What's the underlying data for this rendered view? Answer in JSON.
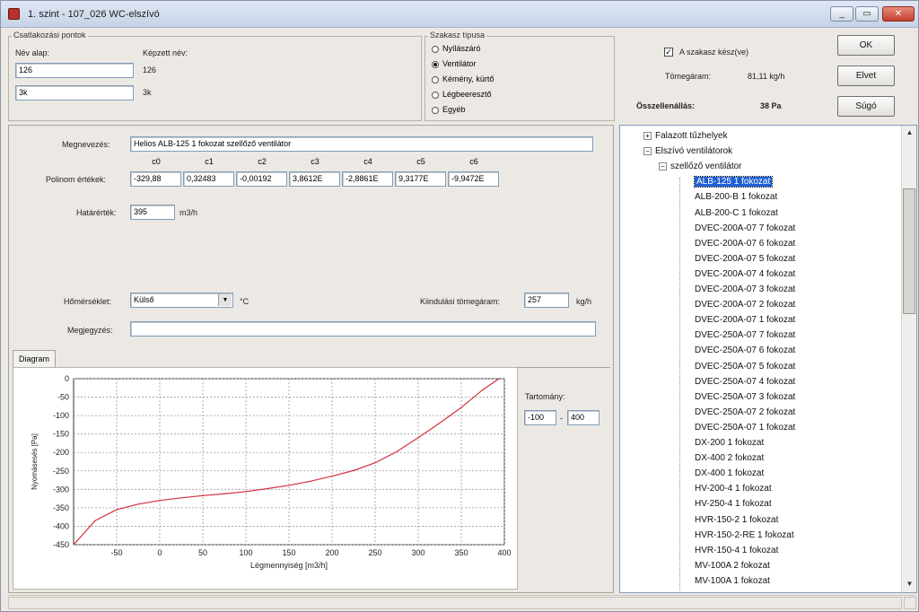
{
  "window": {
    "title": "1. szint - 107_026 WC-elszívó",
    "controls": {
      "minimize": "_",
      "maximize": "▭",
      "close": "✕"
    }
  },
  "connection_points": {
    "group_label": "Csatlakozási pontok",
    "name_base_label": "Név alap:",
    "generated_name_label": "Képzett név:",
    "inputs": [
      "126",
      "3k"
    ],
    "generated": [
      "126",
      "3k"
    ]
  },
  "section_type": {
    "group_label": "Szakasz típusa",
    "options": [
      "Nyílászáró",
      "Ventilátor",
      "Kémény, kürtő",
      "Légbeeresztő",
      "Egyéb"
    ],
    "selected": "Ventilátor"
  },
  "right_info": {
    "checkbox_label": "A szakasz kész(ve)",
    "checkbox_checked": true,
    "mass_flow_label": "Tömegáram:",
    "mass_flow_value": "81,11 kg/h",
    "total_resistance_label": "Összellenállás:",
    "total_resistance_value": "38 Pa"
  },
  "buttons": {
    "ok": "OK",
    "cancel": "Elvet",
    "help": "Súgó"
  },
  "form": {
    "name_label": "Megnevezés:",
    "name_value": "Helios ALB-125 1 fokozat szellőző ventilátor",
    "poly_label": "Polinom értékek:",
    "coef_headers": [
      "c0",
      "c1",
      "c2",
      "c3",
      "c4",
      "c5",
      "c6"
    ],
    "coef_values": [
      "-329,88",
      "0,32483",
      "-0,00192",
      "3,8612E",
      "-2,8861E",
      "9,3177E",
      "-9,9472E"
    ],
    "limit_label": "Határérték:",
    "limit_value": "395",
    "limit_unit": "m3/h",
    "temp_label": "Hőmérséklet:",
    "temp_value": "Külső",
    "temp_unit": "°C",
    "outflow_label": "Kiindulási tömegáram:",
    "outflow_value": "257",
    "outflow_unit": "kg/h",
    "note_label": "Megjegyzés:",
    "note_value": ""
  },
  "tab": {
    "diagram": "Diagram"
  },
  "range": {
    "label": "Tartomány:",
    "from": "-100",
    "sep": "-",
    "to": "400"
  },
  "tree": {
    "nodes": [
      {
        "label": "Falazott tűzhelyek",
        "level": 0,
        "expander": "+"
      },
      {
        "label": "Elszívó ventilátorok",
        "level": 0,
        "expander": "-"
      },
      {
        "label": "szellőző ventilátor",
        "level": 1,
        "expander": "-"
      },
      {
        "label": "ALB-125 1 fokozat",
        "level": 2,
        "selected": true
      },
      {
        "label": "ALB-200-B 1 fokozat",
        "level": 2
      },
      {
        "label": "ALB-200-C 1 fokozat",
        "level": 2
      },
      {
        "label": "DVEC-200A-07 7 fokozat",
        "level": 2
      },
      {
        "label": "DVEC-200A-07 6 fokozat",
        "level": 2
      },
      {
        "label": "DVEC-200A-07 5 fokozat",
        "level": 2
      },
      {
        "label": "DVEC-200A-07 4 fokozat",
        "level": 2
      },
      {
        "label": "DVEC-200A-07 3 fokozat",
        "level": 2
      },
      {
        "label": "DVEC-200A-07 2 fokozat",
        "level": 2
      },
      {
        "label": "DVEC-200A-07 1 fokozat",
        "level": 2
      },
      {
        "label": "DVEC-250A-07 7 fokozat",
        "level": 2
      },
      {
        "label": "DVEC-250A-07 6 fokozat",
        "level": 2
      },
      {
        "label": "DVEC-250A-07 5 fokozat",
        "level": 2
      },
      {
        "label": "DVEC-250A-07 4 fokozat",
        "level": 2
      },
      {
        "label": "DVEC-250A-07 3 fokozat",
        "level": 2
      },
      {
        "label": "DVEC-250A-07 2 fokozat",
        "level": 2
      },
      {
        "label": "DVEC-250A-07 1 fokozat",
        "level": 2
      },
      {
        "label": "DX-200 1 fokozat",
        "level": 2
      },
      {
        "label": "DX-400 2 fokozat",
        "level": 2
      },
      {
        "label": "DX-400 1 fokozat",
        "level": 2
      },
      {
        "label": "HV-200-4 1 fokozat",
        "level": 2
      },
      {
        "label": "HV-250-4 1 fokozat",
        "level": 2
      },
      {
        "label": "HVR-150-2 1 fokozat",
        "level": 2
      },
      {
        "label": "HVR-150-2-RE 1 fokozat",
        "level": 2
      },
      {
        "label": "HVR-150-4 1 fokozat",
        "level": 2
      },
      {
        "label": "MV-100A 2 fokozat",
        "level": 2
      },
      {
        "label": "MV-100A 1 fokozat",
        "level": 2
      }
    ]
  },
  "chart_data": {
    "type": "line",
    "xlabel": "Légmennyiség [m3/h]",
    "ylabel": "Nyomásesés [Pa]",
    "xlim": [
      -100,
      400
    ],
    "ylim": [
      -450,
      0
    ],
    "xticks": [
      -50,
      0,
      50,
      100,
      150,
      200,
      250,
      300,
      350,
      400
    ],
    "yticks": [
      0,
      -50,
      -100,
      -150,
      -200,
      -250,
      -300,
      -350,
      -400,
      -450
    ],
    "grid": true,
    "series_color": "#d2313b",
    "series": [
      {
        "x": [
          -100,
          -75,
          -50,
          -25,
          0,
          25,
          50,
          75,
          100,
          125,
          150,
          175,
          200,
          225,
          250,
          275,
          300,
          325,
          350,
          375,
          400
        ],
        "values": [
          -450,
          -385,
          -355,
          -340,
          -330,
          -323,
          -317,
          -312,
          -306,
          -298,
          -289,
          -278,
          -264,
          -249,
          -228,
          -198,
          -160,
          -120,
          -78,
          -30,
          10
        ]
      }
    ]
  }
}
